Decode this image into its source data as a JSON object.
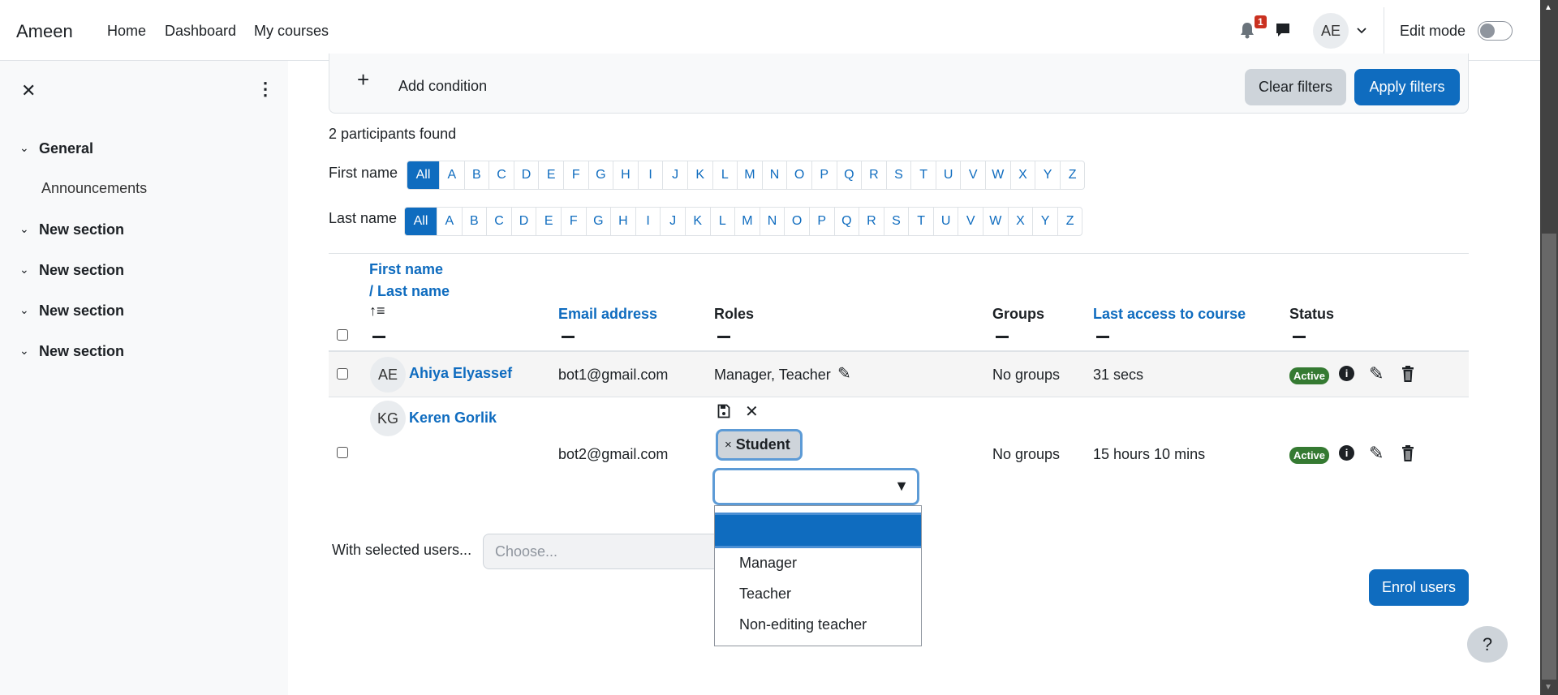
{
  "header": {
    "brand": "Ameen",
    "nav": [
      "Home",
      "Dashboard",
      "My courses"
    ],
    "notification_count": "1",
    "avatar_initials": "AE",
    "edit_mode_label": "Edit mode",
    "edit_mode_on": false
  },
  "sidebar": {
    "items": [
      {
        "label": "General",
        "children": [
          "Announcements"
        ]
      },
      {
        "label": "New section"
      },
      {
        "label": "New section"
      },
      {
        "label": "New section"
      },
      {
        "label": "New section"
      }
    ]
  },
  "filters": {
    "add_condition": "Add condition",
    "clear": "Clear filters",
    "apply": "Apply filters"
  },
  "participants_found": "2 participants found",
  "initials_bar": {
    "first_label": "First name",
    "last_label": "Last name",
    "all": "All",
    "letters": [
      "A",
      "B",
      "C",
      "D",
      "E",
      "F",
      "G",
      "H",
      "I",
      "J",
      "K",
      "L",
      "M",
      "N",
      "O",
      "P",
      "Q",
      "R",
      "S",
      "T",
      "U",
      "V",
      "W",
      "X",
      "Y",
      "Z"
    ]
  },
  "table": {
    "headers": {
      "first": "First name",
      "last": "/ Last name",
      "email": "Email address",
      "roles": "Roles",
      "groups": "Groups",
      "last_access": "Last access to course",
      "status": "Status"
    },
    "rows": [
      {
        "initials": "AE",
        "name": "Ahiya Elyassef",
        "email": "bot1@gmail.com",
        "roles": "Manager, Teacher",
        "groups": "No groups",
        "last_access": "31 secs",
        "status": "Active"
      },
      {
        "initials": "KG",
        "name": "Keren Gorlik",
        "email": "bot2@gmail.com",
        "role_chip": "Student",
        "groups": "No groups",
        "last_access": "15 hours 10 mins",
        "status": "Active"
      }
    ]
  },
  "role_dropdown": {
    "options": [
      "",
      "Manager",
      "Teacher",
      "Non-editing teacher"
    ],
    "highlighted": 0
  },
  "bulk": {
    "label": "With selected users...",
    "placeholder": "Choose..."
  },
  "enrol_label": "Enrol users",
  "help_label": "?",
  "colors": {
    "primary": "#0f6cbf",
    "active_badge": "#357a32",
    "notification": "#ca3120"
  }
}
